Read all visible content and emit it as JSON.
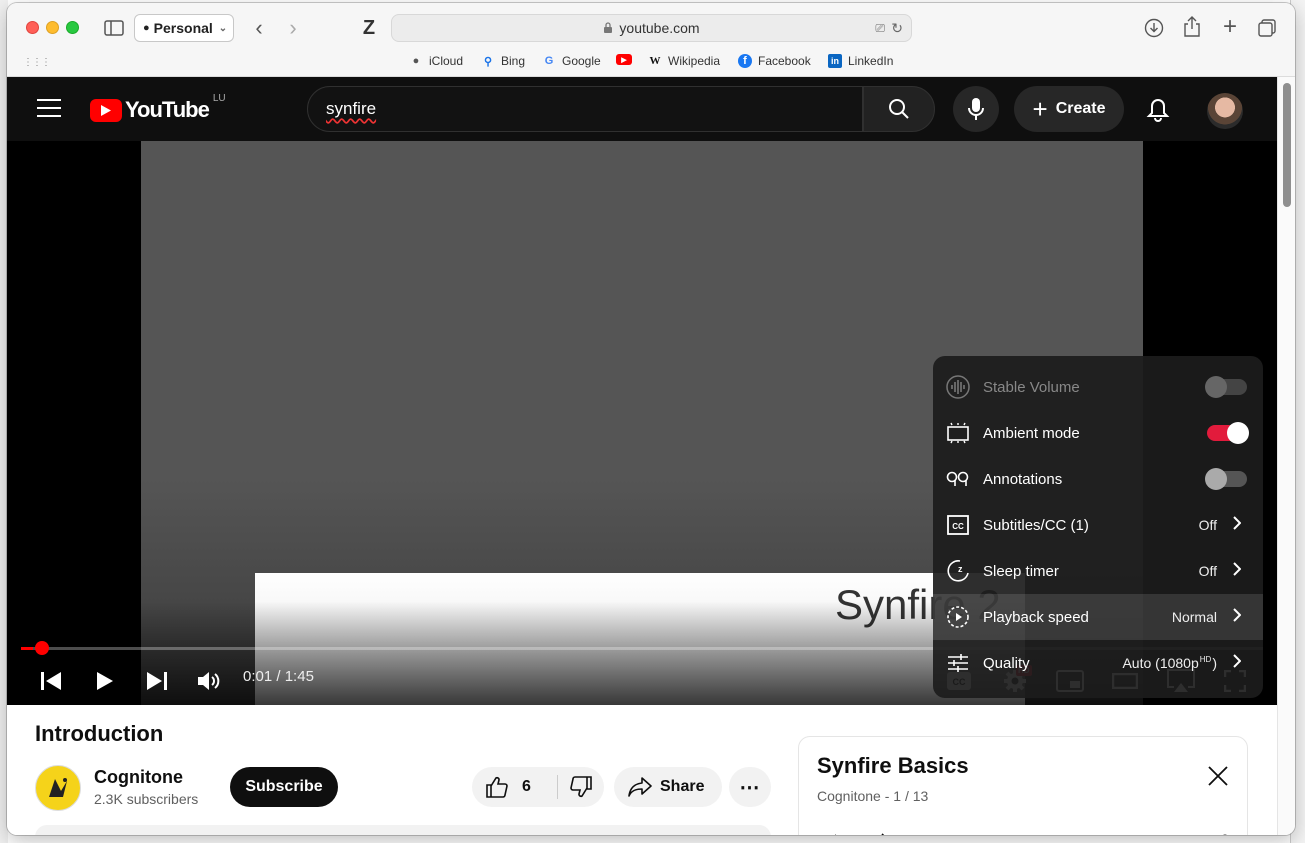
{
  "browser": {
    "profile_label": "Personal",
    "url": "youtube.com",
    "favorites": [
      {
        "label": "iCloud",
        "icon": "apple-icon"
      },
      {
        "label": "Bing",
        "icon": "bing-search-icon"
      },
      {
        "label": "Google",
        "icon": "google-icon"
      },
      {
        "label": "",
        "icon": "youtube-icon"
      },
      {
        "label": "Wikipedia",
        "icon": "wikipedia-icon"
      },
      {
        "label": "Facebook",
        "icon": "facebook-icon"
      },
      {
        "label": "LinkedIn",
        "icon": "linkedin-icon"
      }
    ]
  },
  "youtube": {
    "logo_text": "YouTube",
    "country_code": "LU",
    "search_query": "synfire",
    "create_label": "Create"
  },
  "player": {
    "slide_text": "Synfire 2",
    "time_current": "0:01",
    "time_separator": " / ",
    "time_total": "1:45",
    "progress_fraction": 0.0095,
    "quality_badge": "HD"
  },
  "settings_menu": {
    "items": [
      {
        "label": "Stable Volume",
        "type": "toggle",
        "state": "off",
        "disabled": true
      },
      {
        "label": "Ambient mode",
        "type": "toggle",
        "state": "on"
      },
      {
        "label": "Annotations",
        "type": "toggle",
        "state": "off"
      },
      {
        "label": "Subtitles/CC (1)",
        "type": "submenu",
        "value": "Off"
      },
      {
        "label": "Sleep timer",
        "type": "submenu",
        "value": "Off"
      },
      {
        "label": "Playback speed",
        "type": "submenu",
        "value": "Normal",
        "highlighted": true
      },
      {
        "label": "Quality",
        "type": "submenu",
        "value": "Auto (1080p",
        "value_sup": "HD",
        "value_end": ")"
      }
    ]
  },
  "video": {
    "title": "Introduction",
    "channel_name": "Cognitone",
    "subscriber_count": "2.3K subscribers",
    "subscribe_label": "Subscribe",
    "like_count": "6",
    "share_label": "Share"
  },
  "playlist": {
    "title": "Synfire Basics",
    "subtitle": "Cognitone - 1 / 13"
  },
  "colors": {
    "youtube_red": "#ff0000",
    "toggle_on": "#e21b3c",
    "header_bg": "#0f0f0f"
  }
}
